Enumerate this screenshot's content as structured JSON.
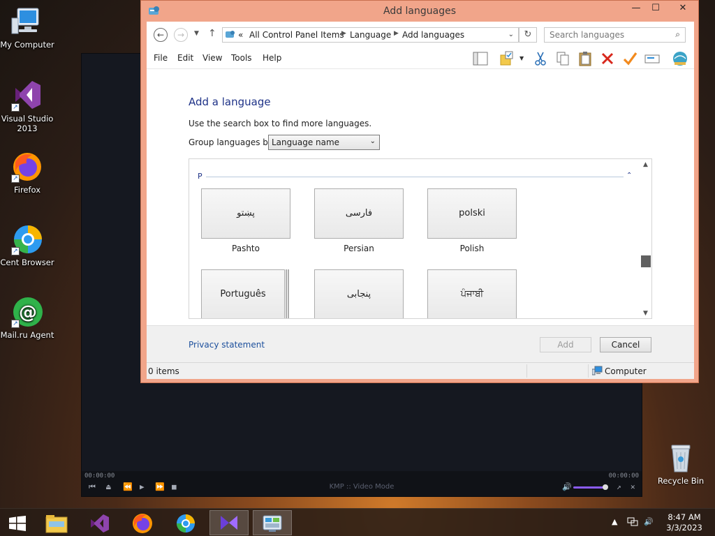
{
  "desktop": {
    "icons": [
      {
        "label": "My Computer"
      },
      {
        "label": "Visual Studio 2013"
      },
      {
        "label": "Firefox"
      },
      {
        "label": "Cent Browser"
      },
      {
        "label": "Mail.ru Agent"
      }
    ],
    "recycle_bin": "Recycle Bin"
  },
  "kmplayer": {
    "time_left": "00:00:00",
    "time_right": "00:00:00",
    "mode_label": "KMP :: Video Mode",
    "volume_fraction": 0.9
  },
  "window": {
    "title": "Add languages",
    "controls": {
      "minimize": "—",
      "maximize": "☐",
      "close": "✕"
    },
    "address": {
      "overflow": "«",
      "breadcrumbs": [
        "All Control Panel Items",
        "Language",
        "Add languages"
      ]
    },
    "search": {
      "placeholder": "Search languages"
    },
    "menu": [
      "File",
      "Edit",
      "View",
      "Tools",
      "Help"
    ],
    "content": {
      "heading": "Add a language",
      "description": "Use the search box to find more languages.",
      "group_label": "Group languages by:",
      "group_value": "Language name",
      "group_letter": "P",
      "languages": [
        {
          "native": "پښتو",
          "name": "Pashto"
        },
        {
          "native": "فارسی",
          "name": "Persian"
        },
        {
          "native": "polski",
          "name": "Polish"
        },
        {
          "native": "Português",
          "name": ""
        },
        {
          "native": "پنجابی",
          "name": ""
        },
        {
          "native": "ਪੰਜਾਬੀ",
          "name": ""
        }
      ]
    },
    "footer": {
      "privacy": "Privacy statement",
      "add": "Add",
      "cancel": "Cancel"
    },
    "status": {
      "items": "0 items",
      "location": "Computer"
    }
  },
  "taskbar": {
    "time": "8:47 AM",
    "date": "3/3/2023"
  },
  "colors": {
    "window_frame": "#f1a58a",
    "heading": "#1e3287",
    "link": "#1c4f9c"
  }
}
